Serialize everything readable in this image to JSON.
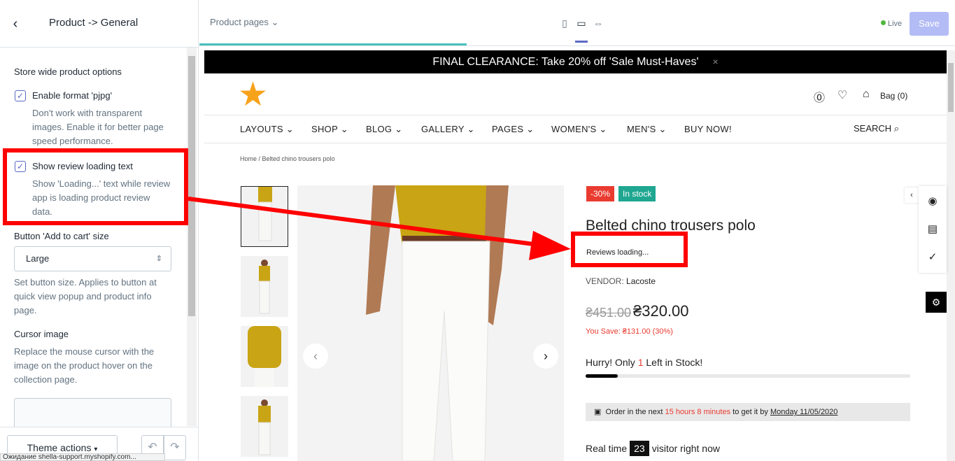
{
  "sidebar": {
    "back_icon": "chevron-left-icon",
    "title": "Product -> General",
    "section_title": "Store wide product options",
    "opt1_label": "Enable format 'pjpg'",
    "opt1_desc": "Don't work with transparent images. Enable it for better page speed performance.",
    "opt2_label": "Show review loading text",
    "opt2_desc": "Show 'Loading...' text while review app is loading product review data.",
    "btn_size_label": "Button 'Add to cart' size",
    "btn_size_value": "Large",
    "btn_size_desc": "Set button size. Applies to button at quick view popup and product info page.",
    "cursor_label": "Cursor image",
    "cursor_desc": "Replace the mouse cursor with the image on the product hover on the collection page.",
    "theme_actions": "Theme actions",
    "status_text": "Ожидание shella-support.myshopify.com..."
  },
  "topbar": {
    "page_select": "Product pages",
    "live": "Live",
    "save": "Save"
  },
  "store": {
    "announcement": "FINAL CLEARANCE: Take 20% off 'Sale Must-Haves'",
    "announcement_close": "×",
    "bag": "Bag (0)",
    "nav": [
      "LAYOUTS ⌄",
      "SHOP ⌄",
      "BLOG ⌄",
      "GALLERY ⌄",
      "PAGES ⌄",
      "WOMEN'S ⌄",
      "MEN'S ⌄",
      "BUY NOW!"
    ],
    "search": "SEARCH",
    "breadcrumb": "Home  /  Belted chino trousers polo",
    "badge_sale": "-30%",
    "badge_stock": "In stock",
    "product_title": "Belted chino trousers polo",
    "reviews": "Reviews loading...",
    "vendor_label": "VENDOR:",
    "vendor": "Lacoste",
    "old_price": "₴451.00",
    "price": "₴320.00",
    "you_save": "You Save: ₴131.00 (30%)",
    "hurry_pre": "Hurry! Only",
    "hurry_num": "1",
    "hurry_post": "Left in Stock!",
    "stock_level": 0.1,
    "order_pre": "Order in the next",
    "order_time": "15 hours 8 minutes",
    "order_mid": "to get it by",
    "order_date": "Monday 11/05/2020",
    "realtime_pre": "Real time",
    "realtime_count": "23",
    "realtime_post": "visitor right now"
  },
  "colors": {
    "accent": "#5c6ac4",
    "highlight": "#ff0000",
    "sale": "#e93b30",
    "stock": "#1fa791",
    "logo": "#f7a21b"
  }
}
